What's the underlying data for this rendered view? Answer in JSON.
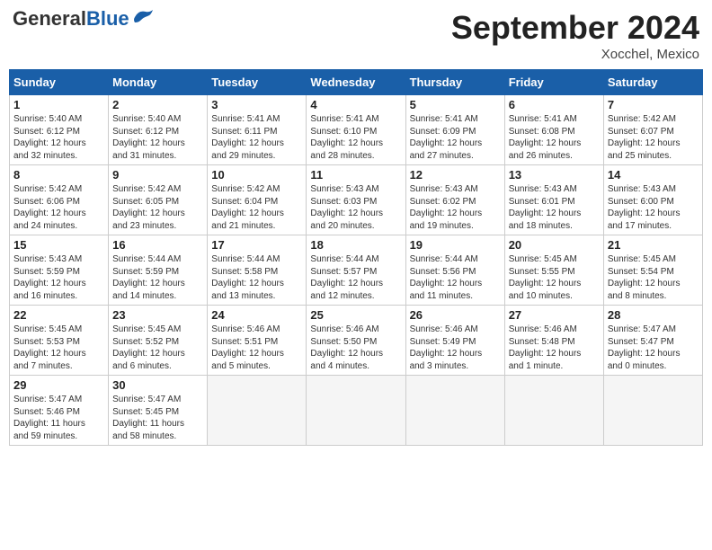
{
  "header": {
    "logo_general": "General",
    "logo_blue": "Blue",
    "month_title": "September 2024",
    "location": "Xocchel, Mexico"
  },
  "weekdays": [
    "Sunday",
    "Monday",
    "Tuesday",
    "Wednesday",
    "Thursday",
    "Friday",
    "Saturday"
  ],
  "weeks": [
    [
      {
        "day": "1",
        "lines": [
          "Sunrise: 5:40 AM",
          "Sunset: 6:12 PM",
          "Daylight: 12 hours",
          "and 32 minutes."
        ]
      },
      {
        "day": "2",
        "lines": [
          "Sunrise: 5:40 AM",
          "Sunset: 6:12 PM",
          "Daylight: 12 hours",
          "and 31 minutes."
        ]
      },
      {
        "day": "3",
        "lines": [
          "Sunrise: 5:41 AM",
          "Sunset: 6:11 PM",
          "Daylight: 12 hours",
          "and 29 minutes."
        ]
      },
      {
        "day": "4",
        "lines": [
          "Sunrise: 5:41 AM",
          "Sunset: 6:10 PM",
          "Daylight: 12 hours",
          "and 28 minutes."
        ]
      },
      {
        "day": "5",
        "lines": [
          "Sunrise: 5:41 AM",
          "Sunset: 6:09 PM",
          "Daylight: 12 hours",
          "and 27 minutes."
        ]
      },
      {
        "day": "6",
        "lines": [
          "Sunrise: 5:41 AM",
          "Sunset: 6:08 PM",
          "Daylight: 12 hours",
          "and 26 minutes."
        ]
      },
      {
        "day": "7",
        "lines": [
          "Sunrise: 5:42 AM",
          "Sunset: 6:07 PM",
          "Daylight: 12 hours",
          "and 25 minutes."
        ]
      }
    ],
    [
      {
        "day": "8",
        "lines": [
          "Sunrise: 5:42 AM",
          "Sunset: 6:06 PM",
          "Daylight: 12 hours",
          "and 24 minutes."
        ]
      },
      {
        "day": "9",
        "lines": [
          "Sunrise: 5:42 AM",
          "Sunset: 6:05 PM",
          "Daylight: 12 hours",
          "and 23 minutes."
        ]
      },
      {
        "day": "10",
        "lines": [
          "Sunrise: 5:42 AM",
          "Sunset: 6:04 PM",
          "Daylight: 12 hours",
          "and 21 minutes."
        ]
      },
      {
        "day": "11",
        "lines": [
          "Sunrise: 5:43 AM",
          "Sunset: 6:03 PM",
          "Daylight: 12 hours",
          "and 20 minutes."
        ]
      },
      {
        "day": "12",
        "lines": [
          "Sunrise: 5:43 AM",
          "Sunset: 6:02 PM",
          "Daylight: 12 hours",
          "and 19 minutes."
        ]
      },
      {
        "day": "13",
        "lines": [
          "Sunrise: 5:43 AM",
          "Sunset: 6:01 PM",
          "Daylight: 12 hours",
          "and 18 minutes."
        ]
      },
      {
        "day": "14",
        "lines": [
          "Sunrise: 5:43 AM",
          "Sunset: 6:00 PM",
          "Daylight: 12 hours",
          "and 17 minutes."
        ]
      }
    ],
    [
      {
        "day": "15",
        "lines": [
          "Sunrise: 5:43 AM",
          "Sunset: 5:59 PM",
          "Daylight: 12 hours",
          "and 16 minutes."
        ]
      },
      {
        "day": "16",
        "lines": [
          "Sunrise: 5:44 AM",
          "Sunset: 5:59 PM",
          "Daylight: 12 hours",
          "and 14 minutes."
        ]
      },
      {
        "day": "17",
        "lines": [
          "Sunrise: 5:44 AM",
          "Sunset: 5:58 PM",
          "Daylight: 12 hours",
          "and 13 minutes."
        ]
      },
      {
        "day": "18",
        "lines": [
          "Sunrise: 5:44 AM",
          "Sunset: 5:57 PM",
          "Daylight: 12 hours",
          "and 12 minutes."
        ]
      },
      {
        "day": "19",
        "lines": [
          "Sunrise: 5:44 AM",
          "Sunset: 5:56 PM",
          "Daylight: 12 hours",
          "and 11 minutes."
        ]
      },
      {
        "day": "20",
        "lines": [
          "Sunrise: 5:45 AM",
          "Sunset: 5:55 PM",
          "Daylight: 12 hours",
          "and 10 minutes."
        ]
      },
      {
        "day": "21",
        "lines": [
          "Sunrise: 5:45 AM",
          "Sunset: 5:54 PM",
          "Daylight: 12 hours",
          "and 8 minutes."
        ]
      }
    ],
    [
      {
        "day": "22",
        "lines": [
          "Sunrise: 5:45 AM",
          "Sunset: 5:53 PM",
          "Daylight: 12 hours",
          "and 7 minutes."
        ]
      },
      {
        "day": "23",
        "lines": [
          "Sunrise: 5:45 AM",
          "Sunset: 5:52 PM",
          "Daylight: 12 hours",
          "and 6 minutes."
        ]
      },
      {
        "day": "24",
        "lines": [
          "Sunrise: 5:46 AM",
          "Sunset: 5:51 PM",
          "Daylight: 12 hours",
          "and 5 minutes."
        ]
      },
      {
        "day": "25",
        "lines": [
          "Sunrise: 5:46 AM",
          "Sunset: 5:50 PM",
          "Daylight: 12 hours",
          "and 4 minutes."
        ]
      },
      {
        "day": "26",
        "lines": [
          "Sunrise: 5:46 AM",
          "Sunset: 5:49 PM",
          "Daylight: 12 hours",
          "and 3 minutes."
        ]
      },
      {
        "day": "27",
        "lines": [
          "Sunrise: 5:46 AM",
          "Sunset: 5:48 PM",
          "Daylight: 12 hours",
          "and 1 minute."
        ]
      },
      {
        "day": "28",
        "lines": [
          "Sunrise: 5:47 AM",
          "Sunset: 5:47 PM",
          "Daylight: 12 hours",
          "and 0 minutes."
        ]
      }
    ],
    [
      {
        "day": "29",
        "lines": [
          "Sunrise: 5:47 AM",
          "Sunset: 5:46 PM",
          "Daylight: 11 hours",
          "and 59 minutes."
        ]
      },
      {
        "day": "30",
        "lines": [
          "Sunrise: 5:47 AM",
          "Sunset: 5:45 PM",
          "Daylight: 11 hours",
          "and 58 minutes."
        ]
      },
      {
        "day": "",
        "lines": []
      },
      {
        "day": "",
        "lines": []
      },
      {
        "day": "",
        "lines": []
      },
      {
        "day": "",
        "lines": []
      },
      {
        "day": "",
        "lines": []
      }
    ]
  ]
}
